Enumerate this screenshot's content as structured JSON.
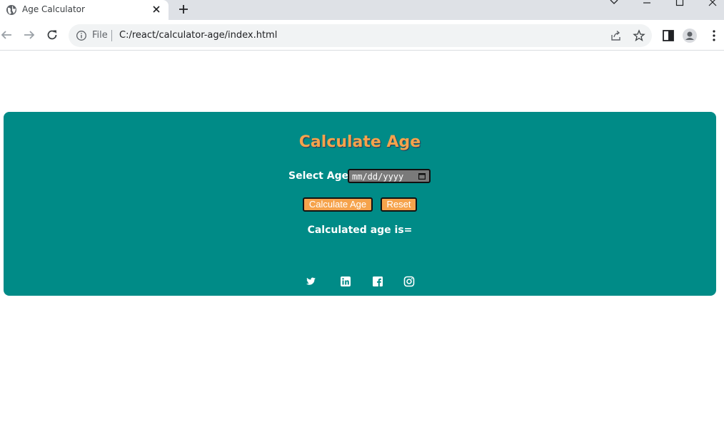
{
  "browser": {
    "tab_title": "Age Calculator",
    "address_scheme": "File",
    "address_url": "C:/react/calculator-age/index.html"
  },
  "app": {
    "heading": "Calculate Age",
    "select_label": "Select Age",
    "date_placeholder": "mm/dd/yyyy",
    "calculate_button": "Calculate Age",
    "reset_button": "Reset",
    "result_label": "Calculated age is=",
    "social_icons": [
      "twitter-icon",
      "linkedin-icon",
      "facebook-icon",
      "instagram-icon"
    ]
  },
  "colors": {
    "card_bg": "#008b87",
    "accent": "#f5a34c"
  }
}
